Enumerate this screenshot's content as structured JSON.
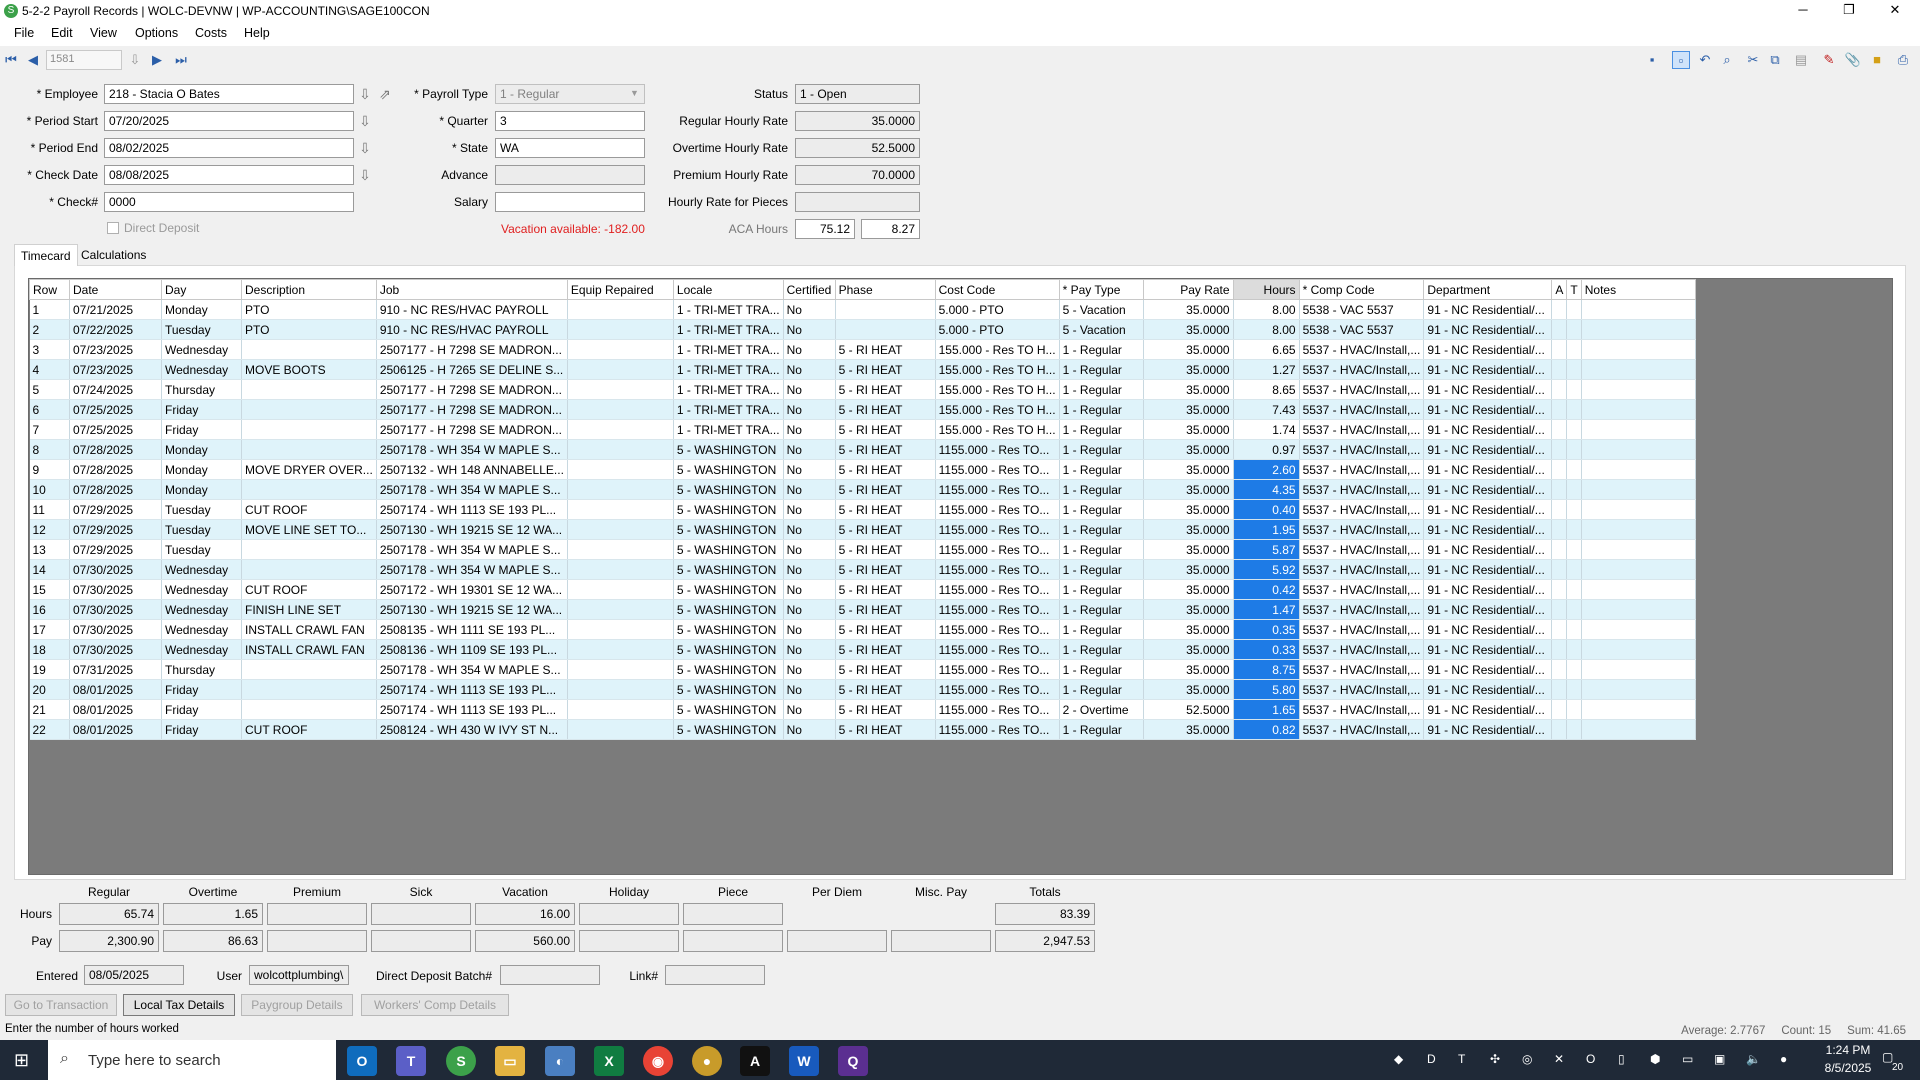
{
  "window": {
    "title": "5-2-2 Payroll Records | WOLC-DEVNW | WP-ACCOUNTING\\SAGE100CON",
    "minimize": "─",
    "maximize": "❐",
    "close": "✕"
  },
  "menu": [
    "File",
    "Edit",
    "View",
    "Options",
    "Costs",
    "Help"
  ],
  "nav": {
    "record": "1581"
  },
  "form": {
    "employee_label": "* Employee",
    "employee": "218 - Stacia O Bates",
    "period_start_label": "* Period Start",
    "period_start": "07/20/2025",
    "period_end_label": "* Period End",
    "period_end": "08/02/2025",
    "check_date_label": "* Check Date",
    "check_date": "08/08/2025",
    "check_no_label": "* Check#",
    "check_no": "0000",
    "direct_deposit_label": "Direct Deposit",
    "payroll_type_label": "* Payroll Type",
    "payroll_type": "1 - Regular",
    "quarter_label": "* Quarter",
    "quarter": "3",
    "state_label": "* State",
    "state": "WA",
    "advance_label": "Advance",
    "advance": "",
    "salary_label": "Salary",
    "salary": "",
    "vacation_available": "Vacation available:  -182.00",
    "status_label": "Status",
    "status": "1 - Open",
    "regular_rate_label": "Regular Hourly Rate",
    "regular_rate": "35.0000",
    "overtime_rate_label": "Overtime Hourly Rate",
    "overtime_rate": "52.5000",
    "premium_rate_label": "Premium Hourly Rate",
    "premium_rate": "70.0000",
    "pieces_rate_label": "Hourly Rate for Pieces",
    "pieces_rate": "",
    "aca_label": "ACA Hours",
    "aca_1": "75.12",
    "aca_2": "8.27"
  },
  "tabs": [
    "Timecard",
    "Calculations"
  ],
  "grid": {
    "columns": [
      "Row",
      "Date",
      "Day",
      "Description",
      "Job",
      "Equip Repaired",
      "Locale",
      "Certified",
      "Phase",
      "Cost Code",
      "* Pay Type",
      "Pay Rate",
      "Hours",
      "* Comp Code",
      "Department",
      "A",
      "T",
      "Notes"
    ],
    "rows": [
      [
        "1",
        "07/21/2025",
        "Monday",
        "PTO",
        "910 - NC RES/HVAC PAYROLL",
        "",
        "1 - TRI-MET TRA...",
        "No",
        "",
        "5.000 - PTO",
        "5 - Vacation",
        "35.0000",
        "8.00",
        "5538 - VAC 5537",
        "91 - NC Residential/...",
        "",
        "",
        ""
      ],
      [
        "2",
        "07/22/2025",
        "Tuesday",
        "PTO",
        "910 - NC RES/HVAC PAYROLL",
        "",
        "1 - TRI-MET TRA...",
        "No",
        "",
        "5.000 - PTO",
        "5 - Vacation",
        "35.0000",
        "8.00",
        "5538 - VAC 5537",
        "91 - NC Residential/...",
        "",
        "",
        ""
      ],
      [
        "3",
        "07/23/2025",
        "Wednesday",
        "",
        "2507177 - H 7298 SE MADRON...",
        "",
        "1 - TRI-MET TRA...",
        "No",
        "5 - RI HEAT",
        "155.000 - Res TO H...",
        "1 - Regular",
        "35.0000",
        "6.65",
        "5537 - HVAC/Install,...",
        "91 - NC Residential/...",
        "",
        "",
        ""
      ],
      [
        "4",
        "07/23/2025",
        "Wednesday",
        "MOVE BOOTS",
        "2506125 - H 7265 SE DELINE S...",
        "",
        "1 - TRI-MET TRA...",
        "No",
        "5 - RI HEAT",
        "155.000 - Res TO H...",
        "1 - Regular",
        "35.0000",
        "1.27",
        "5537 - HVAC/Install,...",
        "91 - NC Residential/...",
        "",
        "",
        ""
      ],
      [
        "5",
        "07/24/2025",
        "Thursday",
        "",
        "2507177 - H 7298 SE MADRON...",
        "",
        "1 - TRI-MET TRA...",
        "No",
        "5 - RI HEAT",
        "155.000 - Res TO H...",
        "1 - Regular",
        "35.0000",
        "8.65",
        "5537 - HVAC/Install,...",
        "91 - NC Residential/...",
        "",
        "",
        ""
      ],
      [
        "6",
        "07/25/2025",
        "Friday",
        "",
        "2507177 - H 7298 SE MADRON...",
        "",
        "1 - TRI-MET TRA...",
        "No",
        "5 - RI HEAT",
        "155.000 - Res TO H...",
        "1 - Regular",
        "35.0000",
        "7.43",
        "5537 - HVAC/Install,...",
        "91 - NC Residential/...",
        "",
        "",
        ""
      ],
      [
        "7",
        "07/25/2025",
        "Friday",
        "",
        "2507177 - H 7298 SE MADRON...",
        "",
        "1 - TRI-MET TRA...",
        "No",
        "5 - RI HEAT",
        "155.000 - Res TO H...",
        "1 - Regular",
        "35.0000",
        "1.74",
        "5537 - HVAC/Install,...",
        "91 - NC Residential/...",
        "",
        "",
        ""
      ],
      [
        "8",
        "07/28/2025",
        "Monday",
        "",
        "2507178 - WH 354 W MAPLE S...",
        "",
        "5 - WASHINGTON",
        "No",
        "5 - RI HEAT",
        "1155.000 - Res TO...",
        "1 - Regular",
        "35.0000",
        "0.97",
        "5537 - HVAC/Install,...",
        "91 - NC Residential/...",
        "",
        "",
        ""
      ],
      [
        "9",
        "07/28/2025",
        "Monday",
        "MOVE DRYER OVER...",
        "2507132 - WH 148 ANNABELLE...",
        "",
        "5 - WASHINGTON",
        "No",
        "5 - RI HEAT",
        "1155.000 - Res TO...",
        "1 - Regular",
        "35.0000",
        "2.60",
        "5537 - HVAC/Install,...",
        "91 - NC Residential/...",
        "",
        "",
        ""
      ],
      [
        "10",
        "07/28/2025",
        "Monday",
        "",
        "2507178 - WH 354 W MAPLE S...",
        "",
        "5 - WASHINGTON",
        "No",
        "5 - RI HEAT",
        "1155.000 - Res TO...",
        "1 - Regular",
        "35.0000",
        "4.35",
        "5537 - HVAC/Install,...",
        "91 - NC Residential/...",
        "",
        "",
        ""
      ],
      [
        "11",
        "07/29/2025",
        "Tuesday",
        "CUT ROOF",
        "2507174 - WH 1113 SE 193 PL...",
        "",
        "5 - WASHINGTON",
        "No",
        "5 - RI HEAT",
        "1155.000 - Res TO...",
        "1 - Regular",
        "35.0000",
        "0.40",
        "5537 - HVAC/Install,...",
        "91 - NC Residential/...",
        "",
        "",
        ""
      ],
      [
        "12",
        "07/29/2025",
        "Tuesday",
        "MOVE LINE SET TO...",
        "2507130 - WH 19215 SE 12 WA...",
        "",
        "5 - WASHINGTON",
        "No",
        "5 - RI HEAT",
        "1155.000 - Res TO...",
        "1 - Regular",
        "35.0000",
        "1.95",
        "5537 - HVAC/Install,...",
        "91 - NC Residential/...",
        "",
        "",
        ""
      ],
      [
        "13",
        "07/29/2025",
        "Tuesday",
        "",
        "2507178 - WH 354 W MAPLE S...",
        "",
        "5 - WASHINGTON",
        "No",
        "5 - RI HEAT",
        "1155.000 - Res TO...",
        "1 - Regular",
        "35.0000",
        "5.87",
        "5537 - HVAC/Install,...",
        "91 - NC Residential/...",
        "",
        "",
        ""
      ],
      [
        "14",
        "07/30/2025",
        "Wednesday",
        "",
        "2507178 - WH 354 W MAPLE S...",
        "",
        "5 - WASHINGTON",
        "No",
        "5 - RI HEAT",
        "1155.000 - Res TO...",
        "1 - Regular",
        "35.0000",
        "5.92",
        "5537 - HVAC/Install,...",
        "91 - NC Residential/...",
        "",
        "",
        ""
      ],
      [
        "15",
        "07/30/2025",
        "Wednesday",
        "CUT ROOF",
        "2507172 - WH 19301 SE 12 WA...",
        "",
        "5 - WASHINGTON",
        "No",
        "5 - RI HEAT",
        "1155.000 - Res TO...",
        "1 - Regular",
        "35.0000",
        "0.42",
        "5537 - HVAC/Install,...",
        "91 - NC Residential/...",
        "",
        "",
        ""
      ],
      [
        "16",
        "07/30/2025",
        "Wednesday",
        "FINISH LINE SET",
        "2507130 - WH 19215 SE 12 WA...",
        "",
        "5 - WASHINGTON",
        "No",
        "5 - RI HEAT",
        "1155.000 - Res TO...",
        "1 - Regular",
        "35.0000",
        "1.47",
        "5537 - HVAC/Install,...",
        "91 - NC Residential/...",
        "",
        "",
        ""
      ],
      [
        "17",
        "07/30/2025",
        "Wednesday",
        "INSTALL CRAWL FAN",
        "2508135 - WH 1111 SE 193 PL...",
        "",
        "5 - WASHINGTON",
        "No",
        "5 - RI HEAT",
        "1155.000 - Res TO...",
        "1 - Regular",
        "35.0000",
        "0.35",
        "5537 - HVAC/Install,...",
        "91 - NC Residential/...",
        "",
        "",
        ""
      ],
      [
        "18",
        "07/30/2025",
        "Wednesday",
        "INSTALL CRAWL FAN",
        "2508136 - WH 1109 SE 193 PL...",
        "",
        "5 - WASHINGTON",
        "No",
        "5 - RI HEAT",
        "1155.000 - Res TO...",
        "1 - Regular",
        "35.0000",
        "0.33",
        "5537 - HVAC/Install,...",
        "91 - NC Residential/...",
        "",
        "",
        ""
      ],
      [
        "19",
        "07/31/2025",
        "Thursday",
        "",
        "2507178 - WH 354 W MAPLE S...",
        "",
        "5 - WASHINGTON",
        "No",
        "5 - RI HEAT",
        "1155.000 - Res TO...",
        "1 - Regular",
        "35.0000",
        "8.75",
        "5537 - HVAC/Install,...",
        "91 - NC Residential/...",
        "",
        "",
        ""
      ],
      [
        "20",
        "08/01/2025",
        "Friday",
        "",
        "2507174 - WH 1113 SE 193 PL...",
        "",
        "5 - WASHINGTON",
        "No",
        "5 - RI HEAT",
        "1155.000 - Res TO...",
        "1 - Regular",
        "35.0000",
        "5.80",
        "5537 - HVAC/Install,...",
        "91 - NC Residential/...",
        "",
        "",
        ""
      ],
      [
        "21",
        "08/01/2025",
        "Friday",
        "",
        "2507174 - WH 1113 SE 193 PL...",
        "",
        "5 - WASHINGTON",
        "No",
        "5 - RI HEAT",
        "1155.000 - Res TO...",
        "2 - Overtime",
        "52.5000",
        "1.65",
        "5537 - HVAC/Install,...",
        "91 - NC Residential/...",
        "",
        "",
        ""
      ],
      [
        "22",
        "08/01/2025",
        "Friday",
        "CUT ROOF",
        "2508124 - WH 430 W IVY ST N...",
        "",
        "5 - WASHINGTON",
        "No",
        "5 - RI HEAT",
        "1155.000 - Res TO...",
        "1 - Regular",
        "35.0000",
        "0.82",
        "5537 - HVAC/Install,...",
        "91 - NC Residential/...",
        "",
        "",
        ""
      ]
    ]
  },
  "summary": {
    "headers": [
      "Regular",
      "Overtime",
      "Premium",
      "Sick",
      "Vacation",
      "Holiday",
      "Piece",
      "Per Diem",
      "Misc. Pay",
      "Totals"
    ],
    "hours_label": "Hours",
    "pay_label": "Pay",
    "hours": [
      "65.74",
      "1.65",
      "",
      "",
      "16.00",
      "",
      "",
      "",
      "",
      "83.39"
    ],
    "pay": [
      "2,300.90",
      "86.63",
      "",
      "",
      "560.00",
      "",
      "",
      "",
      "",
      "2,947.53"
    ]
  },
  "footer": {
    "entered_label": "Entered",
    "entered": "08/05/2025",
    "user_label": "User",
    "user": "wolcottplumbing\\",
    "dd_batch_label": "Direct Deposit Batch#",
    "dd_batch": "",
    "link_label": "Link#",
    "link": "",
    "buttons": [
      "Go to Transaction",
      "Local Tax Details",
      "Paygroup Details",
      "Workers' Comp Details"
    ]
  },
  "status": {
    "hint": "Enter the number of hours worked",
    "stats": "Average: 2.7767     Count: 15     Sum: 41.65"
  },
  "taskbar": {
    "search_placeholder": "Type here to search",
    "time": "1:24 PM",
    "date": "8/5/2025",
    "notifications": "20"
  }
}
